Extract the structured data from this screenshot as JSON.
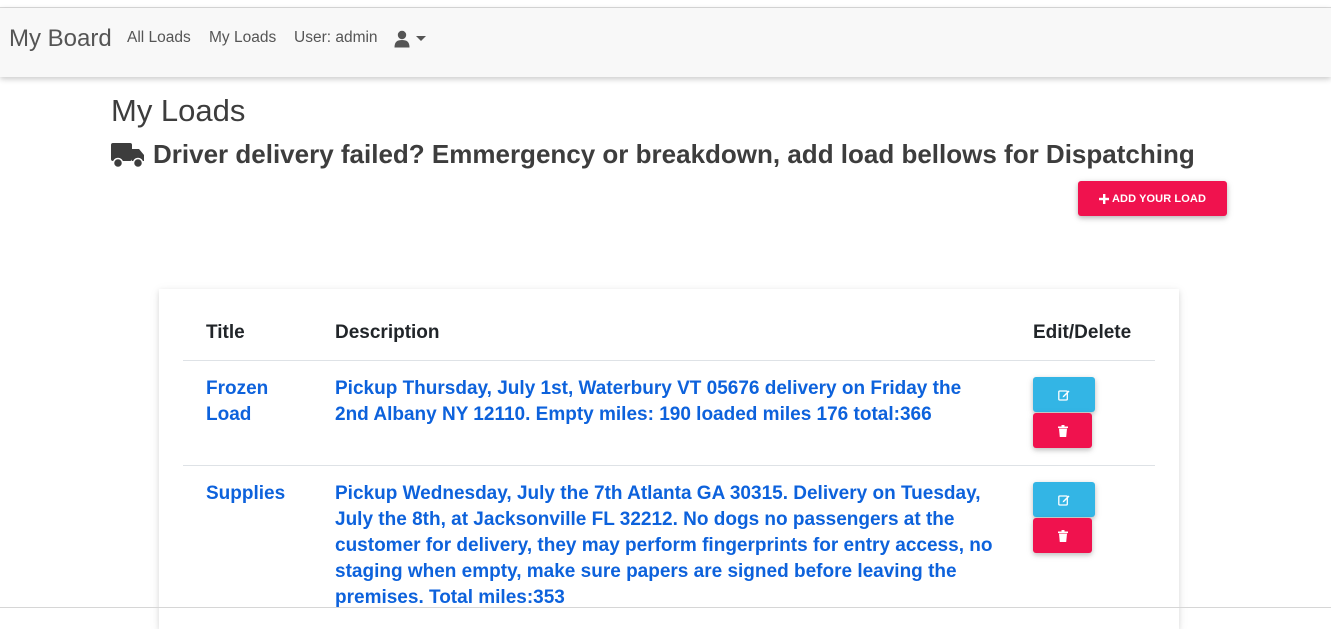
{
  "navbar": {
    "brand": "My Board",
    "links": [
      "All Loads",
      "My Loads",
      "User: admin"
    ],
    "user_menu_icon": "user-icon"
  },
  "page": {
    "title": "My Loads",
    "subtitle": "Driver delivery failed? Emmergency or breakdown, add load bellows for Dispatching",
    "subtitle_icon": "truck-icon",
    "add_button": "ADD YOUR LOAD"
  },
  "table": {
    "headers": [
      "Title",
      "Description",
      "Edit/Delete"
    ],
    "rows": [
      {
        "title": "Frozen Load",
        "description": "Pickup Thursday, July 1st, Waterbury VT 05676 delivery on Friday the 2nd Albany NY 12110. Empty miles: 190 loaded miles 176 total:366"
      },
      {
        "title": "Supplies",
        "description": "Pickup Wednesday, July the 7th Atlanta GA 30315. Delivery on Tuesday, July the 8th, at Jacksonville FL 32212. No dogs no passengers at the customer for delivery, they may perform fingerprints for entry access, no staging when empty, make sure papers are signed before leaving the premises. Total miles:353"
      }
    ],
    "edit_icon": "edit-icon",
    "delete_icon": "trash-icon"
  },
  "colors": {
    "primary_danger": "#f0124e",
    "info": "#33b5e5",
    "link": "#0d62dc"
  }
}
